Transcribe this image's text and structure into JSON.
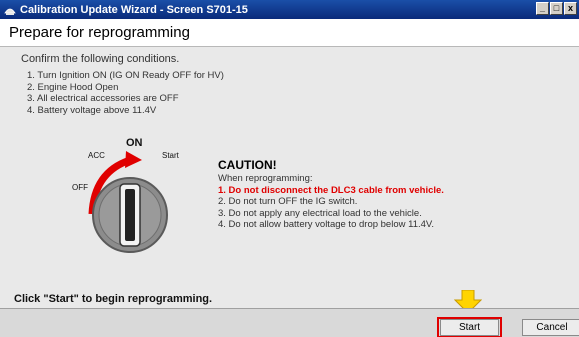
{
  "window": {
    "title": "Calibration Update Wizard - Screen S701-15",
    "icon": "app-icon",
    "buttons": {
      "minimize": "_",
      "maximize": "□",
      "close": "x"
    }
  },
  "header": {
    "title": "Prepare for reprogramming"
  },
  "conditions": {
    "intro": "Confirm the following conditions.",
    "items": [
      "1. Turn Ignition ON (IG ON Ready OFF for HV)",
      "2. Engine Hood Open",
      "3. All electrical accessories are OFF",
      "4. Battery voltage above 11.4V"
    ]
  },
  "ignition_diagram": {
    "labels": {
      "on": "ON",
      "acc": "ACC",
      "off": "OFF",
      "start": "Start"
    },
    "arrow_color": "#e00000"
  },
  "caution": {
    "title": "CAUTION!",
    "subtitle": "When reprogramming:",
    "items": [
      "1. Do not disconnect the DLC3 cable from vehicle.",
      "2. Do not turn OFF the IG switch.",
      "3. Do not apply any electrical load to the vehicle.",
      "4. Do not allow battery voltage to drop below 11.4V."
    ],
    "highlight_color": "#e00000"
  },
  "footer": {
    "instruction": "Click \"Start\" to begin reprogramming.",
    "start_label": "Start",
    "cancel_label": "Cancel"
  },
  "pointer": {
    "icon": "down-arrow-icon",
    "color": "#ffd400"
  }
}
